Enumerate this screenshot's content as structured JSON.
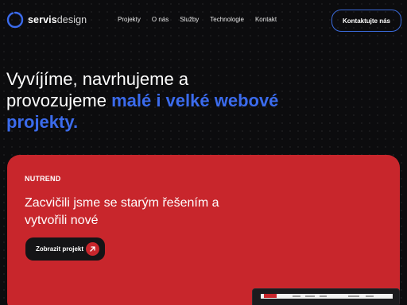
{
  "header": {
    "logo": {
      "brand_bold": "servis",
      "brand_light": "design"
    },
    "nav": [
      "Projekty",
      "O nás",
      "Služby",
      "Technologie",
      "Kontakt"
    ],
    "cta_label": "Kontaktujte nás"
  },
  "hero": {
    "line1": "Vyvíjíme, navrhujeme a",
    "line2_plain": "provozujeme ",
    "line2_accent": "malé i velké webové",
    "line3_accent": "projekty."
  },
  "project_card": {
    "brand": "NUTREND",
    "title": "Zacvičili jsme se starým řešením a vytvořili nové",
    "button_label": "Zobrazit projekt",
    "button_icon": "arrow-up-right-icon"
  },
  "colors": {
    "background": "#0c0c0e",
    "accent_blue": "#3b6bec",
    "card_red": "#c8262c",
    "button_dark": "#141416"
  }
}
